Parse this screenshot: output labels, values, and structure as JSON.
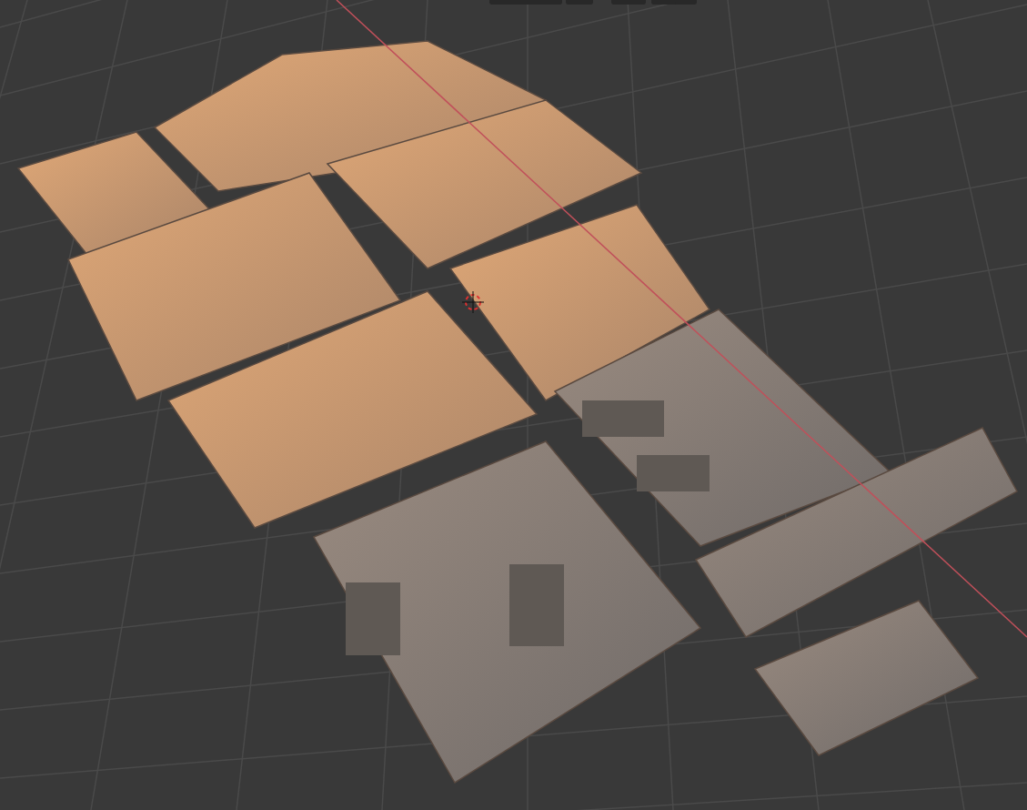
{
  "viewport": {
    "show_x_axis": true,
    "show_3d_cursor": true
  }
}
